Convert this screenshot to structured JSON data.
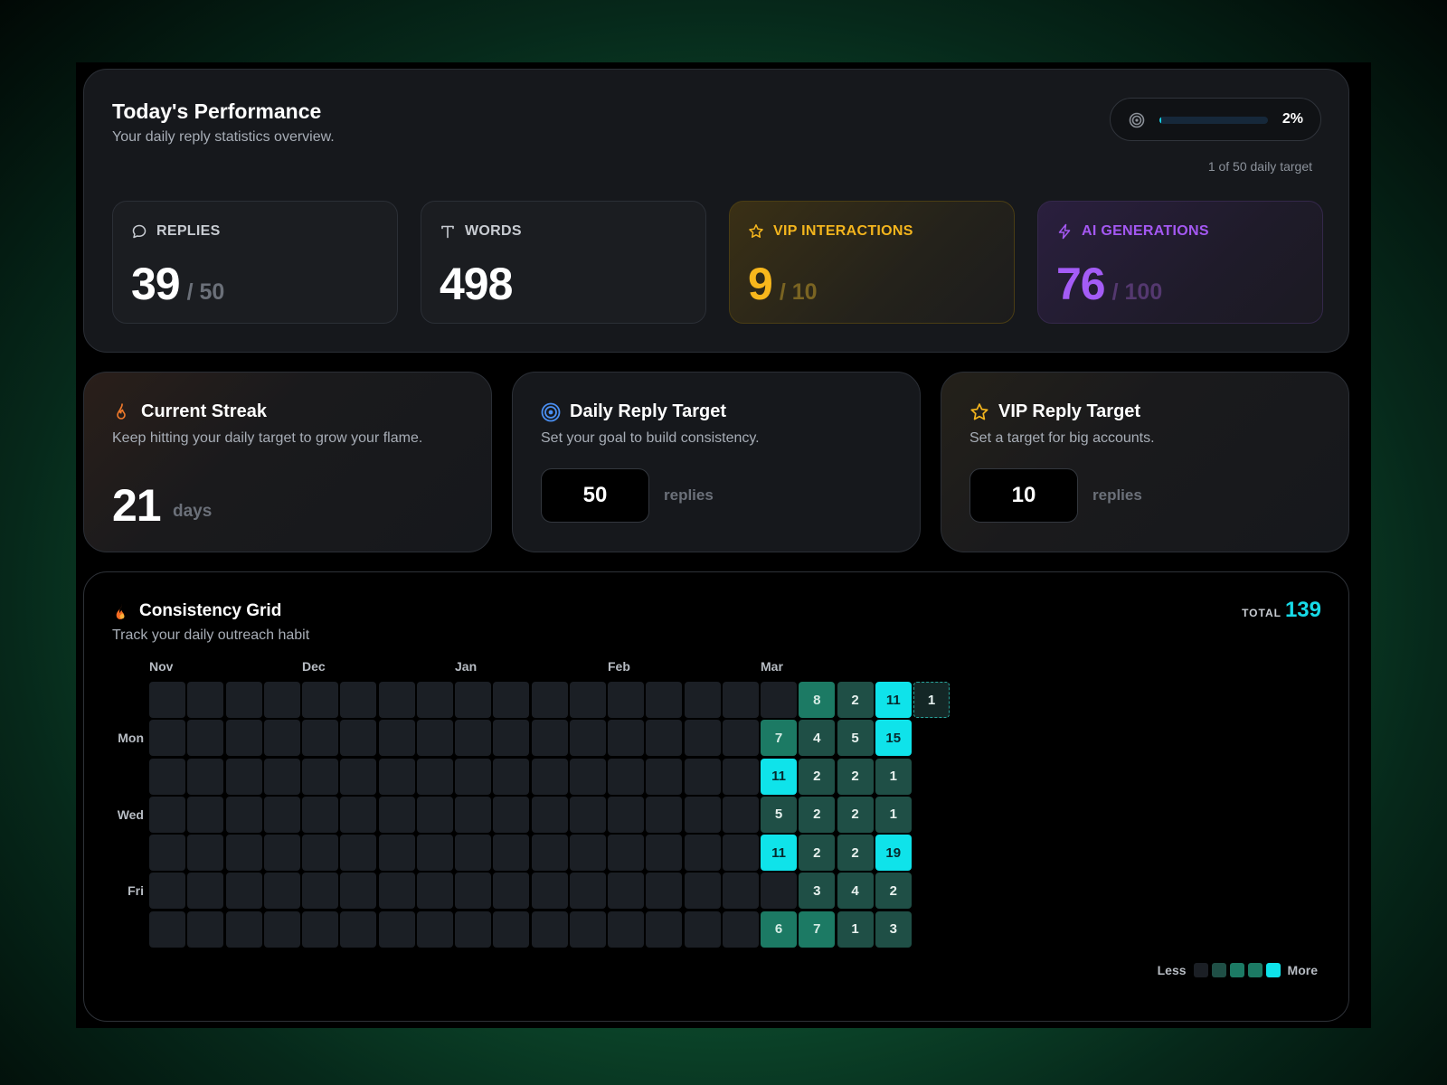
{
  "performance": {
    "title": "Today's Performance",
    "subtitle": "Your daily reply statistics overview.",
    "progress": {
      "percent": 2,
      "percent_label": "2%",
      "caption": "1 of 50 daily target"
    },
    "stats": {
      "replies": {
        "label": "REPLIES",
        "value": "39",
        "denominator": "/ 50",
        "icon": "chat-bubble-icon"
      },
      "words": {
        "label": "WORDS",
        "value": "498",
        "icon": "text-icon"
      },
      "vip": {
        "label": "VIP INTERACTIONS",
        "value": "9",
        "denominator": "/ 10",
        "icon": "star-icon",
        "color": "#f8b71c"
      },
      "ai": {
        "label": "AI GENERATIONS",
        "value": "76",
        "denominator": "/ 100",
        "icon": "bolt-icon",
        "color": "#a45cf6"
      }
    }
  },
  "streak": {
    "title": "Current Streak",
    "subtitle": "Keep hitting your daily target to grow your flame.",
    "value": "21",
    "unit": "days",
    "icon": "flame-icon"
  },
  "daily_target": {
    "title": "Daily Reply Target",
    "subtitle": "Set your goal to build consistency.",
    "value": "50",
    "unit": "replies",
    "icon": "target-icon"
  },
  "vip_target": {
    "title": "VIP Reply Target",
    "subtitle": "Set a target for big accounts.",
    "value": "10",
    "unit": "replies",
    "icon": "star-icon"
  },
  "consistency": {
    "title": "Consistency Grid",
    "subtitle": "Track your daily outreach habit",
    "total_label": "TOTAL",
    "total": "139",
    "months": [
      {
        "label": "Nov",
        "col": 0
      },
      {
        "label": "Dec",
        "col": 4
      },
      {
        "label": "Jan",
        "col": 8
      },
      {
        "label": "Feb",
        "col": 12
      },
      {
        "label": "Mar",
        "col": 16
      }
    ],
    "day_labels": [
      {
        "label": "Mon",
        "row": 1
      },
      {
        "label": "Wed",
        "row": 3
      },
      {
        "label": "Fri",
        "row": 5
      }
    ],
    "columns": 21,
    "active": [
      {
        "col": 16,
        "counts": [
          null,
          7,
          11,
          5,
          11,
          null,
          6
        ]
      },
      {
        "col": 17,
        "counts": [
          8,
          4,
          2,
          2,
          2,
          3,
          7
        ]
      },
      {
        "col": 18,
        "counts": [
          2,
          5,
          2,
          2,
          2,
          4,
          1
        ]
      },
      {
        "col": 19,
        "counts": [
          11,
          15,
          1,
          1,
          19,
          2,
          3
        ]
      },
      {
        "col": 20,
        "counts": [
          1,
          null,
          null,
          null,
          null,
          null,
          null
        ],
        "today_row": 0
      }
    ],
    "legend": {
      "less": "Less",
      "more": "More",
      "colors": [
        "#1b1f25",
        "#1f4f46",
        "#1c7a64",
        "#1c7a64",
        "#0fe3ea"
      ]
    }
  }
}
